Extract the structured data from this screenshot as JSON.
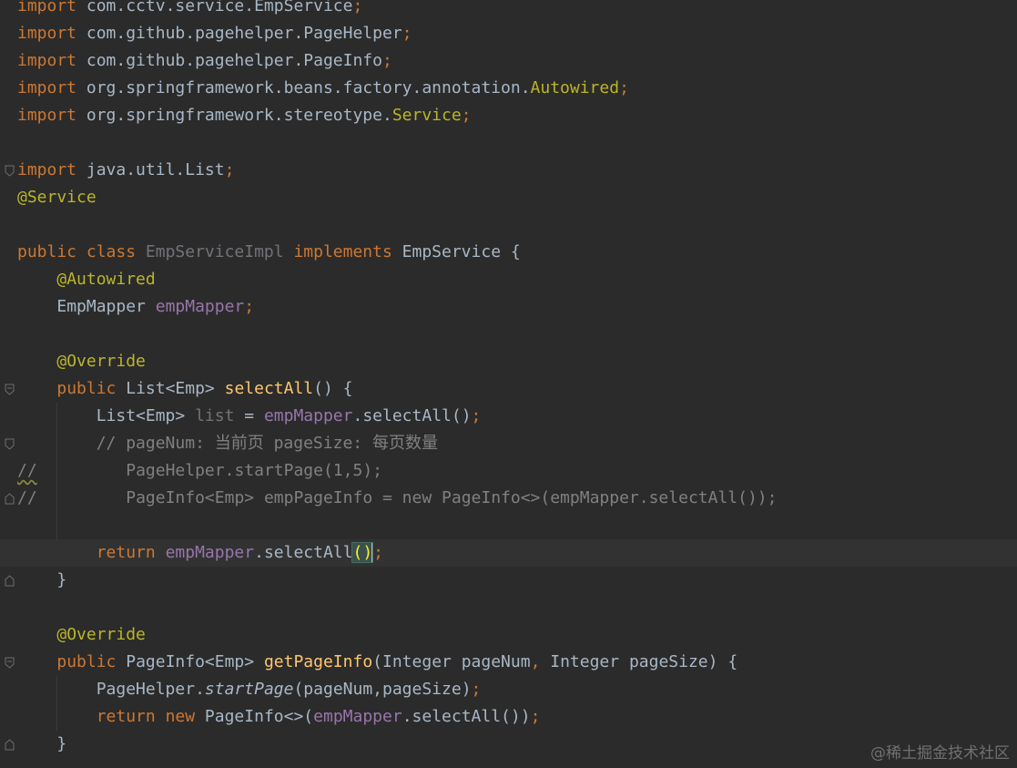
{
  "code": {
    "l1_import": "import",
    "l1_pkg": " com.cctv.service.EmpService",
    "l2_pkg": " com.github.pagehelper.PageHelper",
    "l3_pkg": " com.github.pagehelper.PageInfo",
    "l4_pkg": " org.springframework.beans.factory.annotation.",
    "l4_cls": "Autowired",
    "l5_pkg": " org.springframework.stereotype.",
    "l5_cls": "Service",
    "semi": ";",
    "l7_pkg": " java.util.List",
    "l8_ann": "@Service",
    "l10_public": "public",
    "l10_class": " class ",
    "l10_name": "EmpServiceImpl",
    "l10_implements": " implements ",
    "l10_iface": "EmpService {",
    "l11_ann": "@Autowired",
    "l12_type": "EmpMapper ",
    "l12_field": "empMapper",
    "l14_ann": "@Override",
    "l15_public": "public",
    "l15_type": " List<Emp> ",
    "l15_method": "selectAll",
    "l15_rest": "() {",
    "l16_type": "List<Emp> ",
    "l16_var": "list",
    "l16_eq": " = ",
    "l16_field": "empMapper",
    "l16_call": ".selectAll()",
    "l17_comment": "// pageNum: 当前页 pageSize: 每页数量",
    "l18_prefix": "//",
    "l18_body": "PageHelper.startPage(1,5);",
    "l19_prefix": "//",
    "l19_body": "PageInfo<Emp> empPageInfo = new PageInfo<>(empMapper.selectAll());",
    "l21_return": "return ",
    "l21_field": "empMapper",
    "l21_call": ".selectAll",
    "l21_parens": "()",
    "l22_brace": "}",
    "l24_ann": "@Override",
    "l25_public": "public",
    "l25_type": " PageInfo<Emp> ",
    "l25_method": "getPageInfo",
    "l25_p1": "(Integer pageNum",
    "l25_comma": ", ",
    "l25_p2": "Integer pageSize) {",
    "l26_cls": "PageHelper.",
    "l26_method": "startPage",
    "l26_args": "(pageNum,pageSize)",
    "l27_return": "return ",
    "l27_new": "new ",
    "l27_type": "PageInfo<>(",
    "l27_field": "empMapper",
    "l27_call": ".selectAll())",
    "l28_brace": "}"
  },
  "watermark": "@稀土掘金技术社区",
  "colors": {
    "background": "#2b2b2b",
    "keyword": "#cc7832",
    "annotation": "#bbb529",
    "field": "#9876aa",
    "method": "#ffc66d",
    "comment": "#808080",
    "text": "#a9b7c6"
  },
  "icons": {
    "fold": "fold-marker-icon"
  }
}
